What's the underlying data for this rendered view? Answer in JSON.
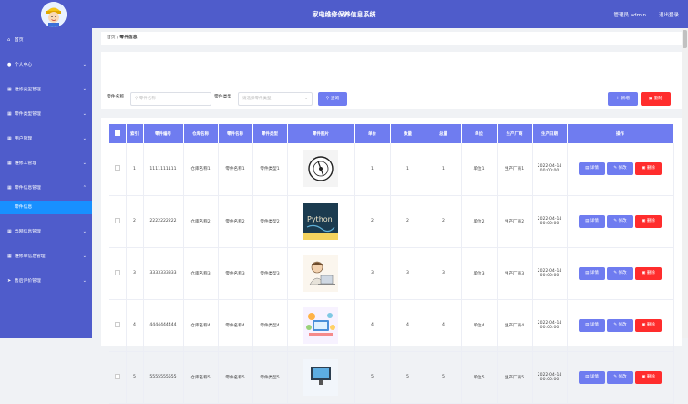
{
  "header": {
    "title": "家电维修保养信息系统",
    "admin_label": "管理员 admin",
    "logout_label": "退出登录"
  },
  "sidebar": {
    "items": [
      {
        "label": "首页",
        "icon": "home-icon",
        "glyph": "⌂"
      },
      {
        "label": "个人中心",
        "icon": "user-icon",
        "glyph": "●"
      },
      {
        "label": "维修类型管理",
        "icon": "grid-icon",
        "glyph": "▦"
      },
      {
        "label": "零件类型管理",
        "icon": "grid-icon",
        "glyph": "▦"
      },
      {
        "label": "用户管理",
        "icon": "grid-icon",
        "glyph": "▦"
      },
      {
        "label": "维修工管理",
        "icon": "grid-icon",
        "glyph": "▦"
      },
      {
        "label": "零件信息管理",
        "icon": "grid-icon",
        "glyph": "▦"
      }
    ],
    "sub_item": "零件信息",
    "items_after": [
      {
        "label": "当网信息管理",
        "icon": "grid-icon",
        "glyph": "▦"
      },
      {
        "label": "维修单信息管理",
        "icon": "grid-icon",
        "glyph": "▦"
      },
      {
        "label": "售后评价管理",
        "icon": "send-icon",
        "glyph": "➤"
      }
    ]
  },
  "breadcrumb": {
    "home": "首页",
    "sep": "/",
    "current": "零件信息"
  },
  "search": {
    "name_label": "零件名称",
    "name_placeholder": "零件名称",
    "type_label": "零件类型",
    "type_placeholder": "请选择零件类型",
    "search_button": "查询",
    "add_button": "新增",
    "delete_button": "删除"
  },
  "table": {
    "headers": [
      "索引",
      "零件编号",
      "仓库名称",
      "零件名称",
      "零件类型",
      "零件图片",
      "单价",
      "数量",
      "总量",
      "单位",
      "生产厂商",
      "生产日期",
      "操作"
    ],
    "rows": [
      {
        "index": "1",
        "code": "1111111111",
        "warehouse": "仓库名称1",
        "name": "零件名称1",
        "type": "零件类型1",
        "price": "1",
        "qty": "1",
        "total": "1",
        "unit": "单位1",
        "maker": "生产厂商1",
        "date": "2022-04-14 00:00:00",
        "image": "phonograph"
      },
      {
        "index": "2",
        "code": "2222222222",
        "warehouse": "仓库名称2",
        "name": "零件名称2",
        "type": "零件类型2",
        "price": "2",
        "qty": "2",
        "total": "2",
        "unit": "单位2",
        "maker": "生产厂商2",
        "date": "2022-04-14 00:00:00",
        "image": "python-book"
      },
      {
        "index": "3",
        "code": "3333333333",
        "warehouse": "仓库名称3",
        "name": "零件名称3",
        "type": "零件类型3",
        "price": "3",
        "qty": "3",
        "total": "3",
        "unit": "单位3",
        "maker": "生产厂商3",
        "date": "2022-04-14 00:00:00",
        "image": "person-laptop"
      },
      {
        "index": "4",
        "code": "4444444444",
        "warehouse": "仓库名称4",
        "name": "零件名称4",
        "type": "零件类型4",
        "price": "4",
        "qty": "4",
        "total": "4",
        "unit": "单位4",
        "maker": "生产厂商4",
        "date": "2022-04-14 00:00:00",
        "image": "desk-workspace"
      },
      {
        "index": "5",
        "code": "5555555555",
        "warehouse": "仓库名称5",
        "name": "零件名称5",
        "type": "零件类型5",
        "price": "5",
        "qty": "5",
        "total": "5",
        "unit": "单位5",
        "maker": "生产厂商5",
        "date": "2022-04-14 00:00:00",
        "image": "monitor"
      }
    ],
    "actions": {
      "detail": "详情",
      "edit": "修改",
      "delete": "删除"
    }
  },
  "colors": {
    "primary": "#4f5ccb",
    "button_blue": "#6f7cf0",
    "button_red": "#ff2d2d",
    "submenu_active": "#1890ff"
  }
}
